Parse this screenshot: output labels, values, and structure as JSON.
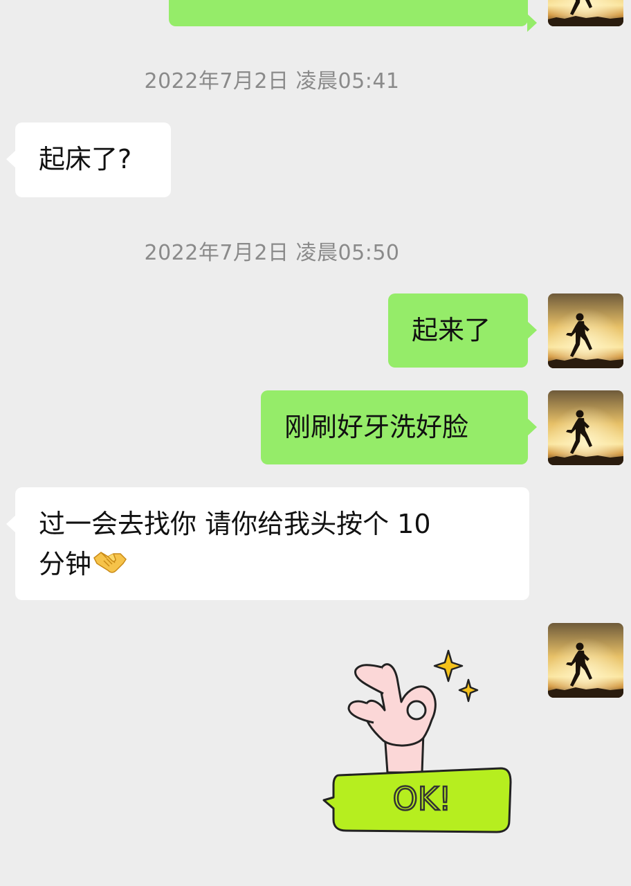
{
  "timestamps": [
    "2022年7月2日 凌晨05:41",
    "2022年7月2日 凌晨05:50"
  ],
  "messages": {
    "m1": "起床了?",
    "m2": "起来了",
    "m3": "刚刷好牙洗好脸",
    "m4_line1": "过一会去找你 请你给我头按个 10",
    "m4_line2": "分钟"
  },
  "sticker": {
    "text": "OK!"
  },
  "colors": {
    "background": "#ededed",
    "outgoing_bubble": "#95ec69",
    "incoming_bubble": "#ffffff",
    "sticker_green": "#b6ee1f"
  },
  "icons": {
    "handshake": "handshake-emoji-icon",
    "avatar": "runner-silhouette-sunset-avatar"
  }
}
